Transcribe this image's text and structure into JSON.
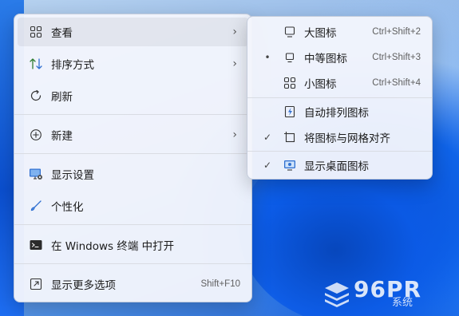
{
  "main_menu": {
    "items": [
      {
        "label": "查看",
        "icon": "grid-icon",
        "has_submenu": true
      },
      {
        "label": "排序方式",
        "icon": "sort-icon",
        "has_submenu": true
      },
      {
        "label": "刷新",
        "icon": "refresh-icon",
        "has_submenu": false
      },
      {
        "label": "新建",
        "icon": "add-circle-icon",
        "has_submenu": true
      },
      {
        "label": "显示设置",
        "icon": "display-settings-icon",
        "has_submenu": false
      },
      {
        "label": "个性化",
        "icon": "brush-icon",
        "has_submenu": false
      },
      {
        "label": "在 Windows 终端 中打开",
        "icon": "terminal-icon",
        "has_submenu": false
      },
      {
        "label": "显示更多选项",
        "icon": "open-external-icon",
        "shortcut": "Shift+F10"
      }
    ],
    "chevron": "›"
  },
  "view_submenu": {
    "items": [
      {
        "label": "大图标",
        "icon": "large-icon-monitor",
        "shortcut": "Ctrl+Shift+2",
        "mark": ""
      },
      {
        "label": "中等图标",
        "icon": "medium-icon-monitor",
        "shortcut": "Ctrl+Shift+3",
        "mark": "•"
      },
      {
        "label": "小图标",
        "icon": "small-icons-grid",
        "shortcut": "Ctrl+Shift+4",
        "mark": ""
      },
      {
        "label": "自动排列图标",
        "icon": "auto-arrange-icon",
        "mark": ""
      },
      {
        "label": "将图标与网格对齐",
        "icon": "align-grid-icon",
        "mark": "✓"
      },
      {
        "label": "显示桌面图标",
        "icon": "show-desktop-icon",
        "mark": "✓"
      }
    ]
  },
  "watermark": {
    "logo": "96PR",
    "text": "系统"
  },
  "colors": {
    "menu_bg": "#f2f5fc",
    "accent": "#0b5ae6"
  }
}
